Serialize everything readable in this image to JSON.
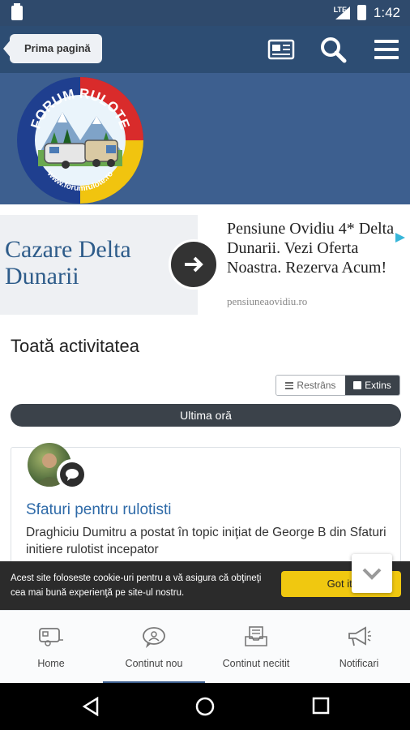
{
  "status_bar": {
    "network": "LTE",
    "time": "1:42"
  },
  "header": {
    "back_label": "Prima pagină"
  },
  "logo": {
    "text_top": "FORUM RULOTE",
    "text_bottom": "www.forumrulote.ro"
  },
  "ad": {
    "left_text": "Cazare Delta Dunarii",
    "right_text": "Pensiune Ovidiu 4* Delta Dunarii. Vezi Oferta Noastra. Rezerva Acum!",
    "url": "pensiuneaovidiu.ro"
  },
  "main": {
    "title": "Toată activitatea",
    "toggle": {
      "collapsed_label": "Restrâns",
      "expanded_label": "Extins",
      "selected": "Extins"
    },
    "time_filter": "Ultima oră",
    "activity": [
      {
        "title": "Sfaturi pentru rulotisti",
        "description": "Draghiciu Dumitru a postat în topic iniţiat de George B din Sfaturi initiere rulotist incepator"
      }
    ]
  },
  "cookie": {
    "text": "Acest site foloseste cookie-uri pentru a vă asigura că obţineţi cea mai bună experienţă pe site-ul nostru.",
    "button": "Got it!"
  },
  "bottom_nav": {
    "items": [
      {
        "label": "Home",
        "icon": "caravan-icon"
      },
      {
        "label": "Continut nou",
        "icon": "chat-bubble-icon",
        "active": true
      },
      {
        "label": "Continut necitit",
        "icon": "inbox-icon"
      },
      {
        "label": "Notificari",
        "icon": "megaphone-icon"
      }
    ]
  },
  "colors": {
    "header": "#2d4d73",
    "logo_area": "#3d5f8f",
    "accent_link": "#2e6aa8",
    "cookie_button": "#f0c810",
    "dark_pill": "#3b424a"
  }
}
